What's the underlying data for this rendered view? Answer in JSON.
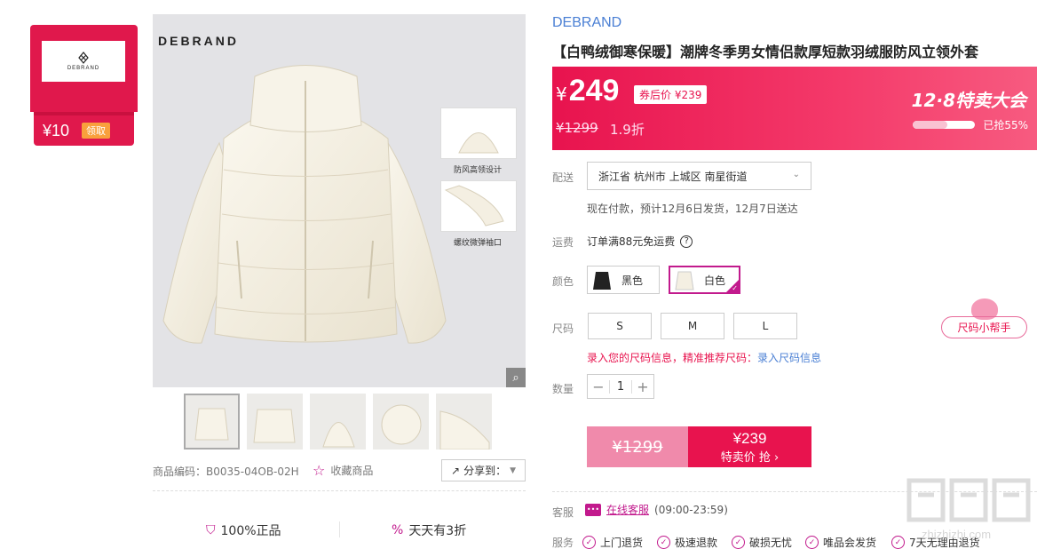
{
  "coupon": {
    "amount": "¥10",
    "claim": "领取",
    "logo_text": "DEBRAND"
  },
  "gallery": {
    "watermark": "DEBRAND",
    "detail_1": "防风高领设计",
    "detail_2": "螺纹微弹袖口",
    "sku": "商品编码：B0035-04OB-02H",
    "favorite": "收藏商品",
    "share": "分享到：",
    "guarantee_1": "100%正品",
    "guarantee_2": "天天有3折"
  },
  "product": {
    "brand": "DEBRAND",
    "title": "【白鸭绒御寒保暖】潮牌冬季男女情侣款厚短款羽绒服防风立领外套"
  },
  "price": {
    "yen": "¥",
    "value": "249",
    "after_coupon": "券后价 ¥239",
    "original": "¥1299",
    "discount": "1.9折",
    "festival": "12·8特卖大会",
    "sold_pct": 0.55,
    "sold": "已抢55%"
  },
  "delivery": {
    "label": "配送",
    "address": "浙江省 杭州市 上城区 南星街道",
    "info": "现在付款，预计12月6日发货，12月7日送达"
  },
  "freight": {
    "label": "运费",
    "text": "订单满88元免运费",
    "help": "?"
  },
  "color": {
    "label": "颜色",
    "options": [
      "黑色",
      "白色"
    ],
    "selected": "白色"
  },
  "size": {
    "label": "尺码",
    "options": [
      "S",
      "M",
      "L"
    ],
    "helper": "尺码小帮手",
    "tip": "录入您的尺码信息，精准推荐尺码：",
    "tip_link": "录入尺码信息"
  },
  "quantity": {
    "label": "数量",
    "minus": "−",
    "value": "1",
    "plus": "+"
  },
  "buy": {
    "original": "¥1299",
    "price": "¥239",
    "action": "特卖价 抢 ›"
  },
  "service": {
    "cs_label": "客服",
    "cs_link": "在线客服",
    "cs_hours": "(09:00-23:59)",
    "label": "服务",
    "items": [
      "上门退货",
      "极速退款",
      "破损无忧",
      "唯品会发货",
      "7天无理由退货"
    ]
  },
  "watermark": {
    "url": "zhizhizhi.com"
  },
  "colors": {
    "accent": "#e8134e",
    "brand_blue": "#4a7fd4",
    "purple": "#c21a8d"
  }
}
